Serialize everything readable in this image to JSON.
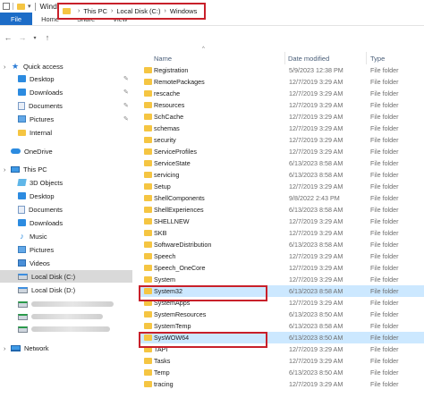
{
  "window": {
    "title": "Windows"
  },
  "ribbon": {
    "tabs": [
      "File",
      "Home",
      "Share",
      "View"
    ]
  },
  "address": {
    "crumbs": [
      "This PC",
      "Local Disk (C:)",
      "Windows"
    ]
  },
  "columns": {
    "name": "Name",
    "date": "Date modified",
    "type": "Type"
  },
  "sidebar": {
    "quick_access": "Quick access",
    "quick_items": [
      "Desktop",
      "Downloads",
      "Documents",
      "Pictures",
      "Internal"
    ],
    "onedrive": "OneDrive",
    "this_pc": "This PC",
    "pc_items": [
      "3D Objects",
      "Desktop",
      "Documents",
      "Downloads",
      "Music",
      "Pictures",
      "Videos",
      "Local Disk (C:)",
      "Local Disk (D:)"
    ],
    "network": "Network"
  },
  "files": [
    {
      "name": "Registration",
      "date": "5/9/2023 12:38 PM",
      "type": "File folder"
    },
    {
      "name": "RemotePackages",
      "date": "12/7/2019 3:29 AM",
      "type": "File folder"
    },
    {
      "name": "rescache",
      "date": "12/7/2019 3:29 AM",
      "type": "File folder"
    },
    {
      "name": "Resources",
      "date": "12/7/2019 3:29 AM",
      "type": "File folder"
    },
    {
      "name": "SchCache",
      "date": "12/7/2019 3:29 AM",
      "type": "File folder"
    },
    {
      "name": "schemas",
      "date": "12/7/2019 3:29 AM",
      "type": "File folder"
    },
    {
      "name": "security",
      "date": "12/7/2019 3:29 AM",
      "type": "File folder"
    },
    {
      "name": "ServiceProfiles",
      "date": "12/7/2019 3:29 AM",
      "type": "File folder"
    },
    {
      "name": "ServiceState",
      "date": "6/13/2023 8:58 AM",
      "type": "File folder"
    },
    {
      "name": "servicing",
      "date": "6/13/2023 8:58 AM",
      "type": "File folder"
    },
    {
      "name": "Setup",
      "date": "12/7/2019 3:29 AM",
      "type": "File folder"
    },
    {
      "name": "ShellComponents",
      "date": "9/8/2022 2:43 PM",
      "type": "File folder"
    },
    {
      "name": "ShellExperiences",
      "date": "6/13/2023 8:58 AM",
      "type": "File folder"
    },
    {
      "name": "SHELLNEW",
      "date": "12/7/2019 3:29 AM",
      "type": "File folder"
    },
    {
      "name": "SKB",
      "date": "12/7/2019 3:29 AM",
      "type": "File folder"
    },
    {
      "name": "SoftwareDistribution",
      "date": "6/13/2023 8:58 AM",
      "type": "File folder"
    },
    {
      "name": "Speech",
      "date": "12/7/2019 3:29 AM",
      "type": "File folder"
    },
    {
      "name": "Speech_OneCore",
      "date": "12/7/2019 3:29 AM",
      "type": "File folder"
    },
    {
      "name": "System",
      "date": "12/7/2019 3:29 AM",
      "type": "File folder"
    },
    {
      "name": "System32",
      "date": "6/13/2023 8:58 AM",
      "type": "File folder"
    },
    {
      "name": "SystemApps",
      "date": "12/7/2019 3:29 AM",
      "type": "File folder"
    },
    {
      "name": "SystemResources",
      "date": "6/13/2023 8:50 AM",
      "type": "File folder"
    },
    {
      "name": "SystemTemp",
      "date": "6/13/2023 8:58 AM",
      "type": "File folder"
    },
    {
      "name": "SysWOW64",
      "date": "6/13/2023 8:50 AM",
      "type": "File folder"
    },
    {
      "name": "TAPI",
      "date": "12/7/2019 3:29 AM",
      "type": "File folder"
    },
    {
      "name": "Tasks",
      "date": "12/7/2019 3:29 AM",
      "type": "File folder"
    },
    {
      "name": "Temp",
      "date": "6/13/2023 8:50 AM",
      "type": "File folder"
    },
    {
      "name": "tracing",
      "date": "12/7/2019 3:29 AM",
      "type": "File folder"
    }
  ]
}
